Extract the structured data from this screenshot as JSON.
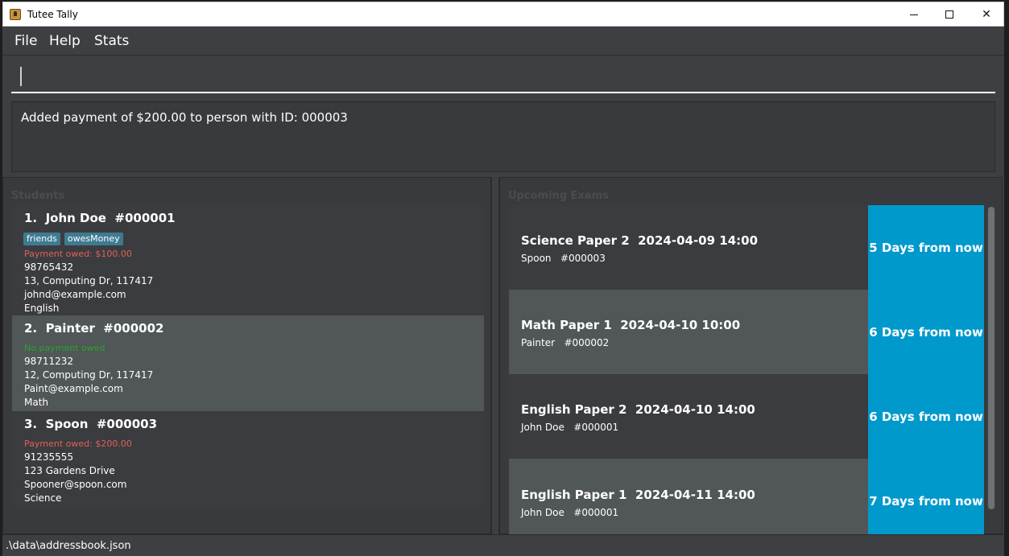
{
  "window": {
    "title": "Tutee Tally"
  },
  "menu": {
    "file": "File",
    "help": "Help",
    "stats": "Stats"
  },
  "command": {
    "value": "",
    "placeholder": ""
  },
  "result": {
    "text": "Added payment of $200.00 to person with ID: 000003"
  },
  "students": {
    "header": "Students",
    "items": [
      {
        "name": "1.  John Doe  #000001",
        "tags": [
          "friends",
          "owesMoney"
        ],
        "payment": "Payment owed: $100.00",
        "payment_status": "owed",
        "phone": "98765432",
        "address": "13, Computing Dr, 117417",
        "email": "johnd@example.com",
        "subject": "English"
      },
      {
        "name": "2.  Painter  #000002",
        "tags": [],
        "payment": "No payment owed",
        "payment_status": "none",
        "phone": "98711232",
        "address": "12, Computing Dr, 117417",
        "email": "Paint@example.com",
        "subject": "Math"
      },
      {
        "name": "3.  Spoon  #000003",
        "tags": [],
        "payment": "Payment owed: $200.00",
        "payment_status": "owed",
        "phone": "91235555",
        "address": "123 Gardens Drive",
        "email": "Spooner@spoon.com",
        "subject": "Science"
      }
    ]
  },
  "exams": {
    "header": "Upcoming Exams",
    "items": [
      {
        "title": "Science Paper 2  2024-04-09 14:00",
        "student": "Spoon   #000003",
        "days": "5 Days from now"
      },
      {
        "title": "Math Paper 1  2024-04-10 10:00",
        "student": "Painter   #000002",
        "days": "6 Days from now"
      },
      {
        "title": "English Paper 2  2024-04-10 14:00",
        "student": "John Doe   #000001",
        "days": "6 Days from now"
      },
      {
        "title": "English Paper 1  2024-04-11 14:00",
        "student": "John Doe   #000001",
        "days": "7 Days from now"
      }
    ]
  },
  "status": {
    "path": ".\\data\\addressbook.json"
  },
  "colors": {
    "accent": "#0099cc",
    "tag": "#3e7b91",
    "owed": "#e0605a",
    "paid": "#2aa32a"
  }
}
